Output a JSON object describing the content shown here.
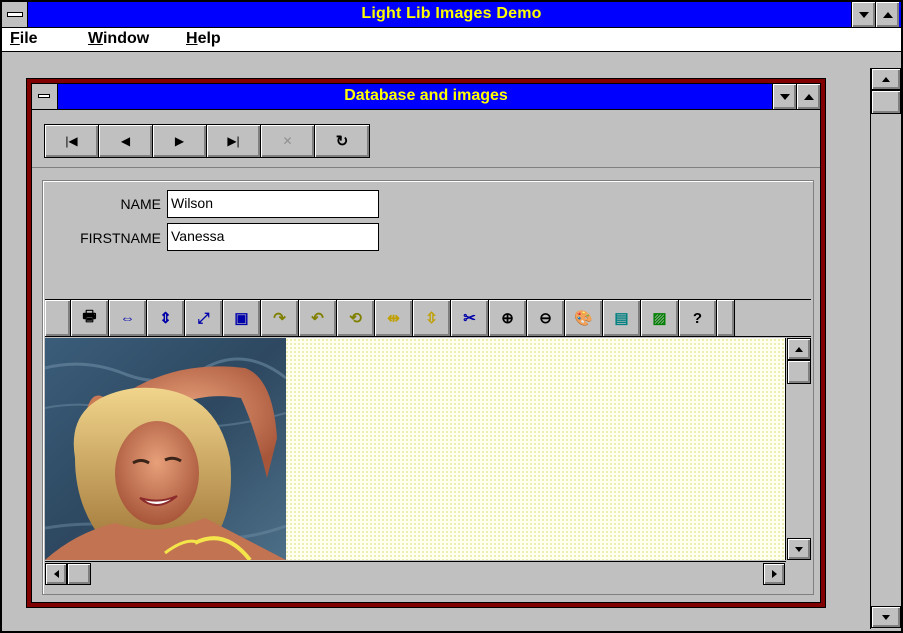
{
  "window": {
    "title": "Light Lib Images Demo",
    "icons": {
      "system": "system-menu-icon",
      "minimize": "minimize-icon",
      "maximize": "maximize-icon"
    }
  },
  "menu": {
    "items": [
      {
        "label": "File",
        "mnemonic": "F"
      },
      {
        "label": "Window",
        "mnemonic": "W"
      },
      {
        "label": "Help",
        "mnemonic": "H"
      }
    ]
  },
  "child": {
    "title": "Database and images"
  },
  "navigator": {
    "buttons": [
      {
        "name": "first-record-button",
        "glyph": "|◀",
        "enabled": true
      },
      {
        "name": "prev-record-button",
        "glyph": "◀",
        "enabled": true
      },
      {
        "name": "next-record-button",
        "glyph": "▶",
        "enabled": true
      },
      {
        "name": "last-record-button",
        "glyph": "▶|",
        "enabled": true
      },
      {
        "name": "cancel-button",
        "glyph": "✕",
        "enabled": false
      },
      {
        "name": "refresh-button",
        "glyph": "↻",
        "enabled": true
      }
    ]
  },
  "form": {
    "name_label": "NAME",
    "name_value": "Wilson",
    "firstname_label": "FIRSTNAME",
    "firstname_value": "Vanessa"
  },
  "image_toolbar": {
    "tools": [
      {
        "name": "print-icon",
        "glyph": "🖶"
      },
      {
        "name": "fit-width-icon",
        "glyph": "⇔"
      },
      {
        "name": "fit-height-icon",
        "glyph": "⇕"
      },
      {
        "name": "fit-window-icon",
        "glyph": "⤢"
      },
      {
        "name": "actual-size-icon",
        "glyph": "▣"
      },
      {
        "name": "rotate-right-icon",
        "glyph": "↷"
      },
      {
        "name": "rotate-left-icon",
        "glyph": "↶"
      },
      {
        "name": "rotate-180-icon",
        "glyph": "⟲"
      },
      {
        "name": "flip-horizontal-icon",
        "glyph": "⇹"
      },
      {
        "name": "flip-vertical-icon",
        "glyph": "⇳"
      },
      {
        "name": "crop-icon",
        "glyph": "✂"
      },
      {
        "name": "zoom-in-icon",
        "glyph": "⊕"
      },
      {
        "name": "zoom-out-icon",
        "glyph": "⊖"
      },
      {
        "name": "palette-icon",
        "glyph": "🎨"
      },
      {
        "name": "color-depth-icon",
        "glyph": "▤"
      },
      {
        "name": "image-properties-icon",
        "glyph": "▨"
      },
      {
        "name": "help-icon",
        "glyph": "?"
      }
    ]
  },
  "colors": {
    "title_bar": "#0000ff",
    "title_text": "#ffff00",
    "child_border": "#800000",
    "face": "#c0c0c0"
  }
}
